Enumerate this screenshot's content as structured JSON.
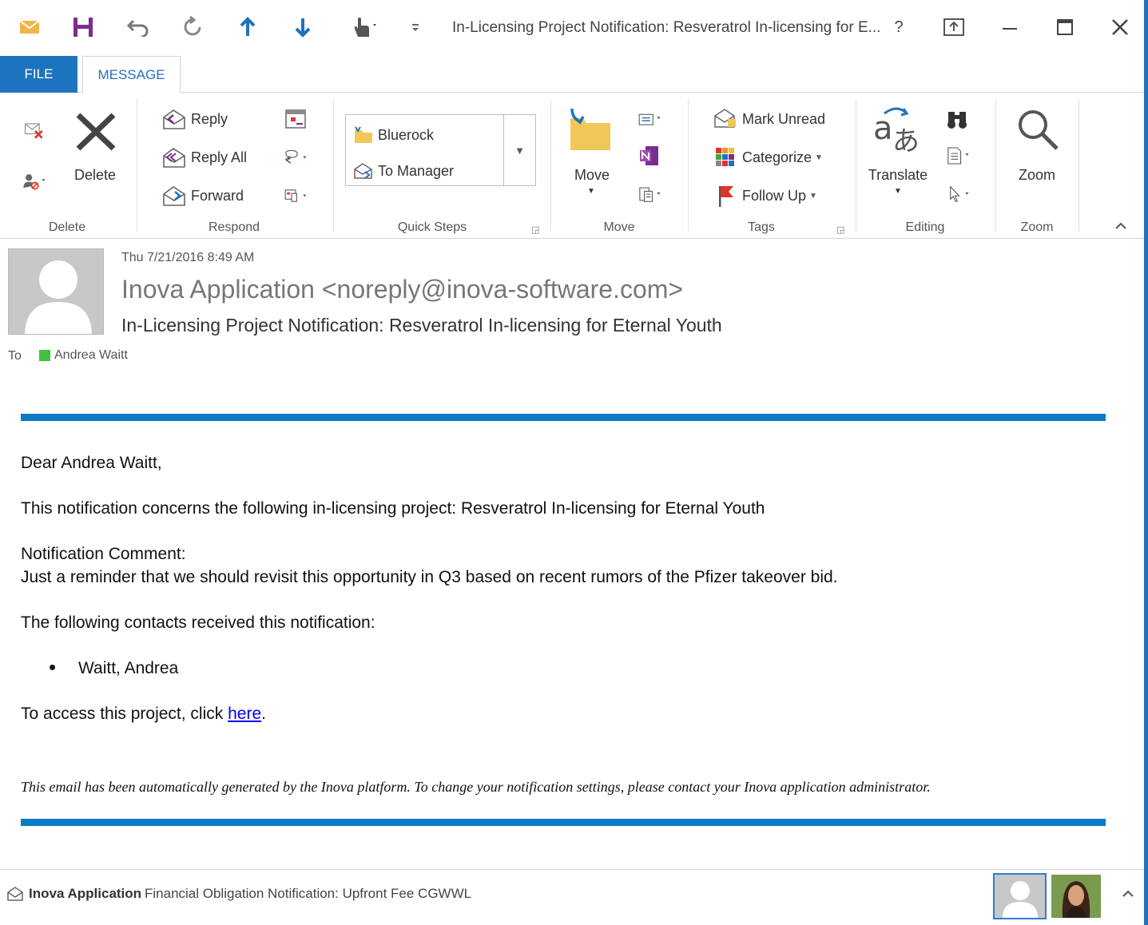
{
  "window": {
    "title": "In-Licensing Project Notification: Resveratrol In-licensing for E...",
    "help": "?",
    "accent": "#1e73be"
  },
  "tabs": {
    "file": "FILE",
    "message": "MESSAGE"
  },
  "ribbon": {
    "delete_group": {
      "label": "Delete",
      "delete": "Delete"
    },
    "respond_group": {
      "label": "Respond",
      "reply": "Reply",
      "reply_all": "Reply All",
      "forward": "Forward"
    },
    "quick_steps_group": {
      "label": "Quick Steps",
      "step1": "Bluerock",
      "step2": "To Manager"
    },
    "move_group": {
      "label": "Move",
      "move": "Move"
    },
    "tags_group": {
      "label": "Tags",
      "mark_unread": "Mark Unread",
      "categorize": "Categorize",
      "follow_up": "Follow Up"
    },
    "editing_group": {
      "label": "Editing",
      "translate": "Translate"
    },
    "zoom_group": {
      "label": "Zoom",
      "zoom": "Zoom"
    }
  },
  "message": {
    "date": "Thu 7/21/2016 8:49 AM",
    "from": "Inova Application <noreply@inova-software.com>",
    "subject": "In-Licensing Project Notification: Resveratrol In-licensing for Eternal Youth",
    "to_label": "To",
    "to_name": "Andrea Waitt",
    "body": {
      "greeting": "Dear Andrea Waitt,",
      "line1": "This notification concerns the following in-licensing project: Resveratrol In-licensing for Eternal Youth",
      "comment_label": "Notification Comment:",
      "comment": "Just a reminder that we should revisit this opportunity in Q3 based on recent rumors of the Pfizer takeover bid.",
      "contacts_label": "The following contacts received this notification:",
      "contact1": "Waitt, Andrea",
      "access_prefix": "To access this project, click ",
      "access_link": "here",
      "access_suffix": ".",
      "disclaimer": "This email has been automatically generated by the Inova platform. To change your notification settings, please contact your Inova application administrator."
    }
  },
  "people_pane": {
    "sender": "Inova Application",
    "item": "Financial Obligation Notification: Upfront Fee CGWWL"
  }
}
